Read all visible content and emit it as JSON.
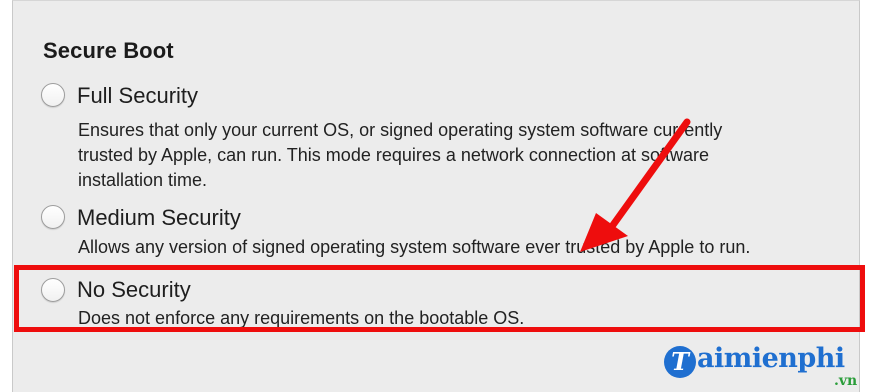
{
  "section_title": "Secure Boot",
  "options": [
    {
      "label": "Full Security",
      "description_lines": [
        "Ensures that only your current OS, or signed operating system software currently",
        "trusted by Apple, can run. This mode requires a network connection at software",
        "installation time."
      ],
      "selected": false
    },
    {
      "label": "Medium Security",
      "description_lines": [
        "Allows any version of signed operating system software ever trusted by Apple to run."
      ],
      "selected": false
    },
    {
      "label": "No Security",
      "description_lines": [
        "Does not enforce any requirements on the bootable OS."
      ],
      "selected": false
    }
  ],
  "annotation": {
    "highlight_color": "#ee0d0d",
    "arrow_color": "#ee0d0d",
    "highlighted_option": "No Security"
  },
  "watermark": {
    "mark": "T",
    "text": "aimienphi",
    "suffix": ".vn",
    "color": "#1f6fd0",
    "suffix_color": "#2a9d3a"
  }
}
